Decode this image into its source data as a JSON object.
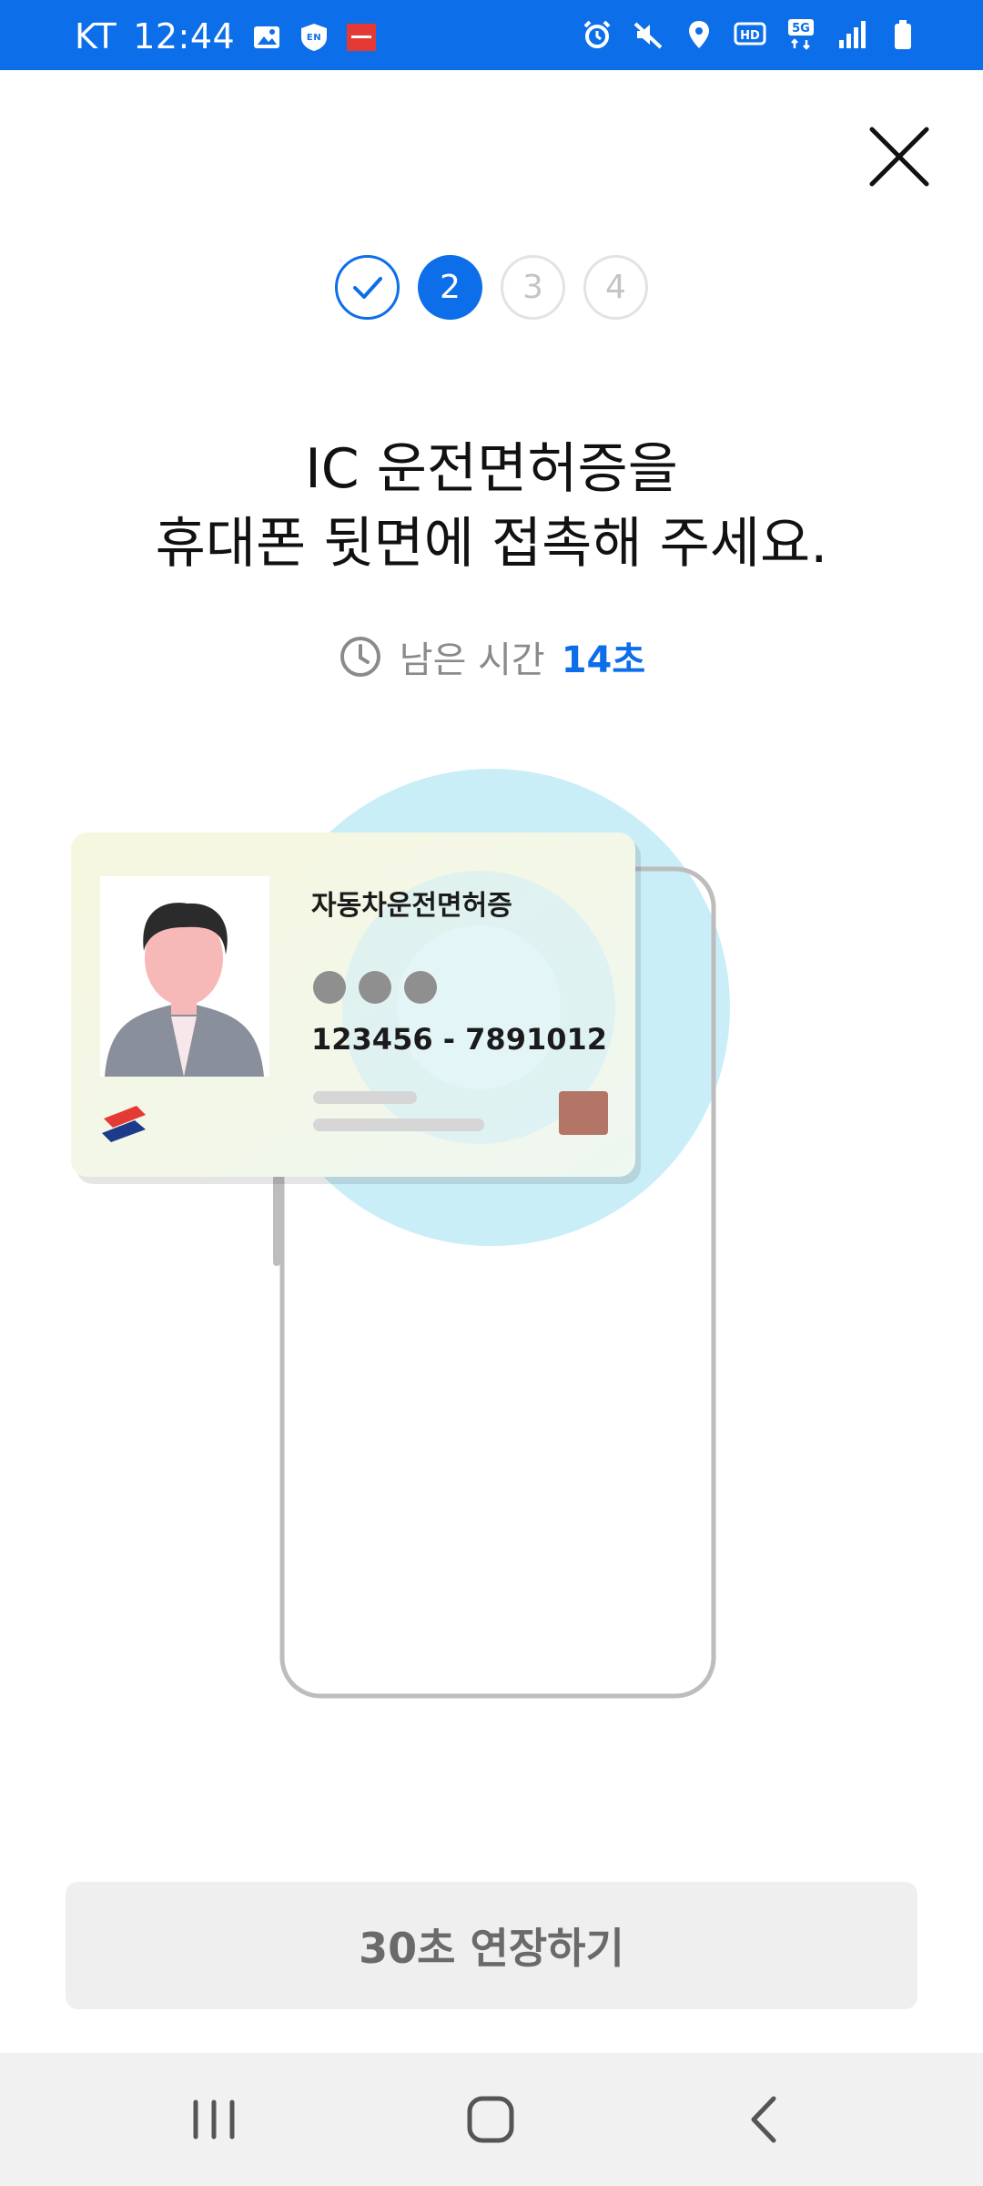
{
  "status_bar": {
    "carrier": "KT",
    "time": "12:44",
    "bg_color": "#0c6ee8",
    "left_icons": [
      "gallery-icon",
      "shield-en-icon",
      "app-badge-icon"
    ],
    "right_icons": [
      "alarm-icon",
      "mute-icon",
      "location-icon",
      "hd-voice-icon",
      "5g-icon",
      "signal-icon",
      "battery-icon"
    ],
    "hd_label": "HD",
    "network_label": "5G"
  },
  "stepper": {
    "steps": [
      {
        "label": "",
        "state": "done"
      },
      {
        "label": "2",
        "state": "active"
      },
      {
        "label": "3",
        "state": "pending"
      },
      {
        "label": "4",
        "state": "pending"
      }
    ],
    "accent_color": "#0c6ee8"
  },
  "headline": {
    "line1": "IC 운전면허증을",
    "line2": "휴대폰 뒷면에 접촉해 주세요."
  },
  "timer": {
    "label": "남은 시간",
    "value": "14초"
  },
  "license_card": {
    "title": "자동차운전면허증",
    "number": "123456 - 7891012"
  },
  "extend_button": {
    "label": "30초 연장하기"
  },
  "nav_bar": {
    "items": [
      "recents-icon",
      "home-icon",
      "back-icon"
    ]
  }
}
